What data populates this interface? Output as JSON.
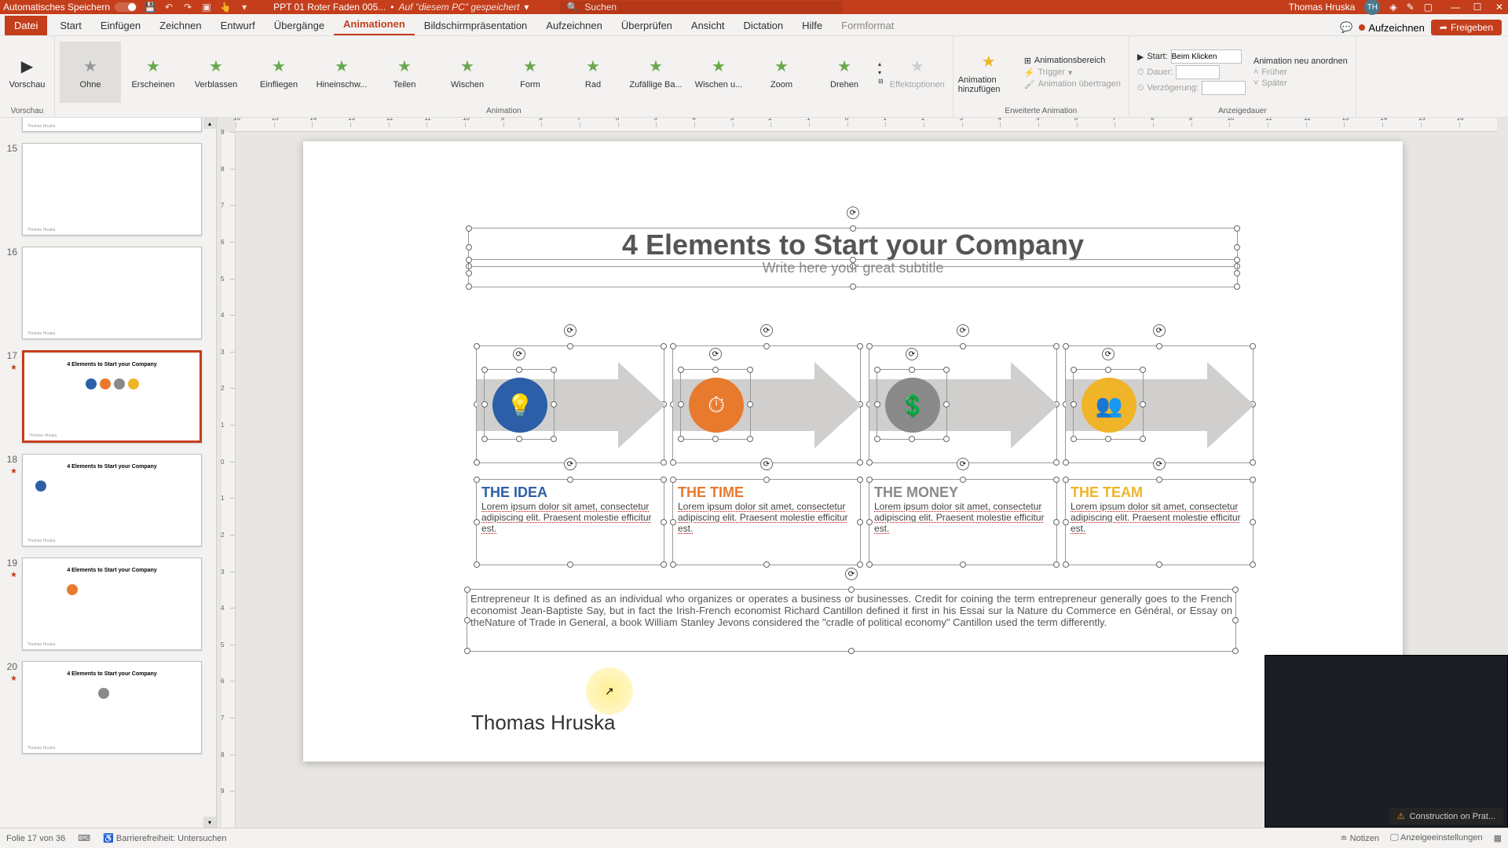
{
  "titlebar": {
    "autosave": "Automatisches Speichern",
    "filename": "PPT 01 Roter Faden 005...",
    "saved_location": "Auf \"diesem PC\" gespeichert",
    "search_placeholder": "Suchen",
    "username": "Thomas Hruska",
    "user_initials": "TH"
  },
  "tabs": {
    "file": "Datei",
    "items": [
      "Start",
      "Einfügen",
      "Zeichnen",
      "Entwurf",
      "Übergänge",
      "Animationen",
      "Bildschirmpräsentation",
      "Aufzeichnen",
      "Überprüfen",
      "Ansicht",
      "Dictation",
      "Hilfe"
    ],
    "context": "Formformat",
    "active": "Animationen",
    "record": "Aufzeichnen",
    "share": "Freigeben"
  },
  "ribbon": {
    "preview": "Vorschau",
    "anims": [
      "Ohne",
      "Erscheinen",
      "Verblassen",
      "Einfliegen",
      "Hineinschw...",
      "Teilen",
      "Wischen",
      "Form",
      "Rad",
      "Zufällige Ba...",
      "Wischen u...",
      "Zoom",
      "Drehen"
    ],
    "selected_anim": "Ohne",
    "effect_options": "Effektoptionen",
    "group_anim": "Animation",
    "add_anim": "Animation hinzufügen",
    "anim_pane": "Animationsbereich",
    "trigger": "Trigger",
    "anim_transfer": "Animation übertragen",
    "group_ext": "Erweiterte Animation",
    "start_label": "Start:",
    "start_value": "Beim Klicken",
    "duration": "Dauer:",
    "delay": "Verzögerung:",
    "reorder": "Animation neu anordnen",
    "earlier": "Früher",
    "later": "Später",
    "group_timing": "Anzeigedauer"
  },
  "ruler_h": [
    "16",
    "15",
    "14",
    "13",
    "12",
    "11",
    "10",
    "9",
    "8",
    "7",
    "6",
    "5",
    "4",
    "3",
    "2",
    "1",
    "0",
    "1",
    "2",
    "3",
    "4",
    "5",
    "6",
    "7",
    "8",
    "9",
    "10",
    "11",
    "12",
    "13",
    "14",
    "15",
    "16"
  ],
  "ruler_v": [
    "9",
    "8",
    "7",
    "6",
    "5",
    "4",
    "3",
    "2",
    "1",
    "0",
    "1",
    "2",
    "3",
    "4",
    "5",
    "6",
    "7",
    "8",
    "9"
  ],
  "thumbs": [
    {
      "n": "15"
    },
    {
      "n": "16"
    },
    {
      "n": "17",
      "active": true,
      "title": "4 Elements to Start your Company"
    },
    {
      "n": "18",
      "title": "4 Elements to Start your Company"
    },
    {
      "n": "19",
      "title": "4 Elements to Start your Company"
    },
    {
      "n": "20",
      "title": "4 Elements to Start your Company"
    }
  ],
  "slide": {
    "title": "4 Elements to Start your Company",
    "subtitle": "Write here your great subtitle",
    "cards": [
      {
        "title": "THE IDEA",
        "color": "#2d5fa8",
        "icon": "💡",
        "body": "Lorem ipsum dolor sit amet, consectetur adipiscing elit. Praesent molestie efficitur est."
      },
      {
        "title": "THE TIME",
        "color": "#e87a2e",
        "icon": "⏱",
        "body": "Lorem ipsum dolor sit amet, consectetur adipiscing elit. Praesent molestie efficitur est."
      },
      {
        "title": "THE MONEY",
        "color": "#8a8a8a",
        "icon": "💲",
        "body": "Lorem ipsum dolor sit amet, consectetur adipiscing elit. Praesent molestie efficitur est."
      },
      {
        "title": "THE TEAM",
        "color": "#f0b428",
        "icon": "👥",
        "body": "Lorem ipsum dolor sit amet, consectetur adipiscing elit. Praesent molestie efficitur est."
      }
    ],
    "paragraph": "Entrepreneur   It is defined as an individual who organizes or operates a business or businesses. Credit for coining the term entrepreneur generally goes to the French economist Jean-Baptiste Say, but in fact the Irish-French economist Richard Cantillon defined it first in his Essai sur la Nature du Commerce en Général, or Essay on theNature of Trade in General, a book William Stanley Jevons considered the \"cradle of political economy\" Cantillon used the term differently.",
    "footer": "Thomas Hruska"
  },
  "status": {
    "slide_count": "Folie 17 von 36",
    "accessibility": "Barrierefreiheit: Untersuchen",
    "notes": "Notizen",
    "display": "Anzeigeeinstellungen"
  },
  "news": "Construction on Prat..."
}
